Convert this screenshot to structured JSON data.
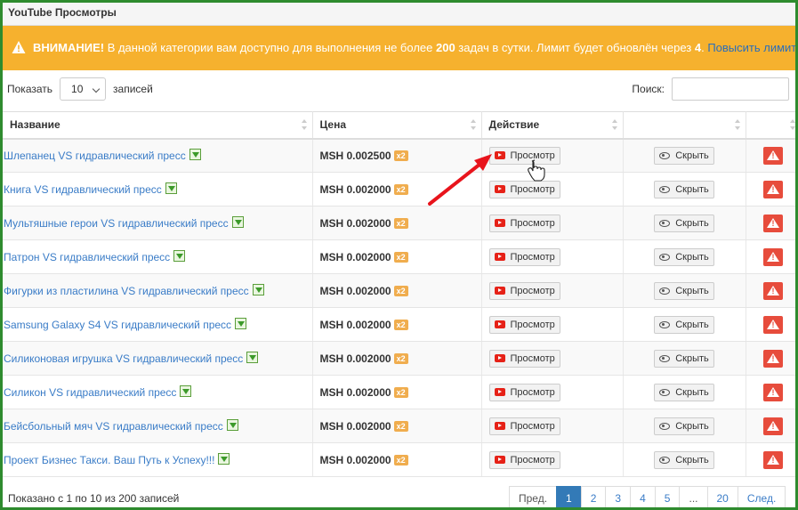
{
  "panel": {
    "title": "YouTube Просмотры"
  },
  "alert": {
    "prefix": "ВНИМАНИЕ!",
    "text1": " В данной категории вам доступно для выполнения не более ",
    "limit": "200",
    "text2": " задач в сутки. Лимит будет обновлён через ",
    "hours": "4",
    "text3": ". ",
    "link": "Повысить лимит",
    "colors": {
      "background": "#f6b12e",
      "link": "#2a6ebb"
    }
  },
  "controls": {
    "show_label": "Показать",
    "page_size": "10",
    "records_label": "записей",
    "search_label": "Поиск:",
    "search_value": ""
  },
  "columns": [
    "Название",
    "Цена",
    "Действие",
    "",
    ""
  ],
  "buttons": {
    "view": "Просмотр",
    "hide": "Скрыть"
  },
  "rows": [
    {
      "name": "Шлепанец VS гидравлический пресс",
      "price": "MSH 0.002500",
      "badge": "x2"
    },
    {
      "name": "Книга VS гидравлический пресс",
      "price": "MSH 0.002000",
      "badge": "x2"
    },
    {
      "name": "Мультяшные герои VS гидравлический пресс",
      "price": "MSH 0.002000",
      "badge": "x2"
    },
    {
      "name": "Патрон VS гидравлический пресс",
      "price": "MSH 0.002000",
      "badge": "x2"
    },
    {
      "name": "Фигурки из пластилина VS гидравлический пресс",
      "price": "MSH 0.002000",
      "badge": "x2"
    },
    {
      "name": "Samsung Galaxy S4 VS гидравлический пресс",
      "price": "MSH 0.002000",
      "badge": "x2"
    },
    {
      "name": "Силиконовая игрушка VS гидравлический пресс",
      "price": "MSH 0.002000",
      "badge": "x2"
    },
    {
      "name": "Силикон VS гидравлический пресс",
      "price": "MSH 0.002000",
      "badge": "x2"
    },
    {
      "name": "Бейсбольный мяч VS гидравлический пресс",
      "price": "MSH 0.002000",
      "badge": "x2"
    },
    {
      "name": "Проект Бизнес Такси. Ваш Путь к Успеху!!!",
      "price": "MSH 0.002000",
      "badge": "x2"
    }
  ],
  "footer": {
    "info": "Показано с 1 по 10 из 200 записей"
  },
  "pagination": [
    "Пред.",
    "1",
    "2",
    "3",
    "4",
    "5",
    "...",
    "20",
    "След."
  ],
  "pagination_active": "1",
  "annotation": {
    "arrow_color": "#e8141c",
    "icon": "hand-cursor-icon"
  }
}
